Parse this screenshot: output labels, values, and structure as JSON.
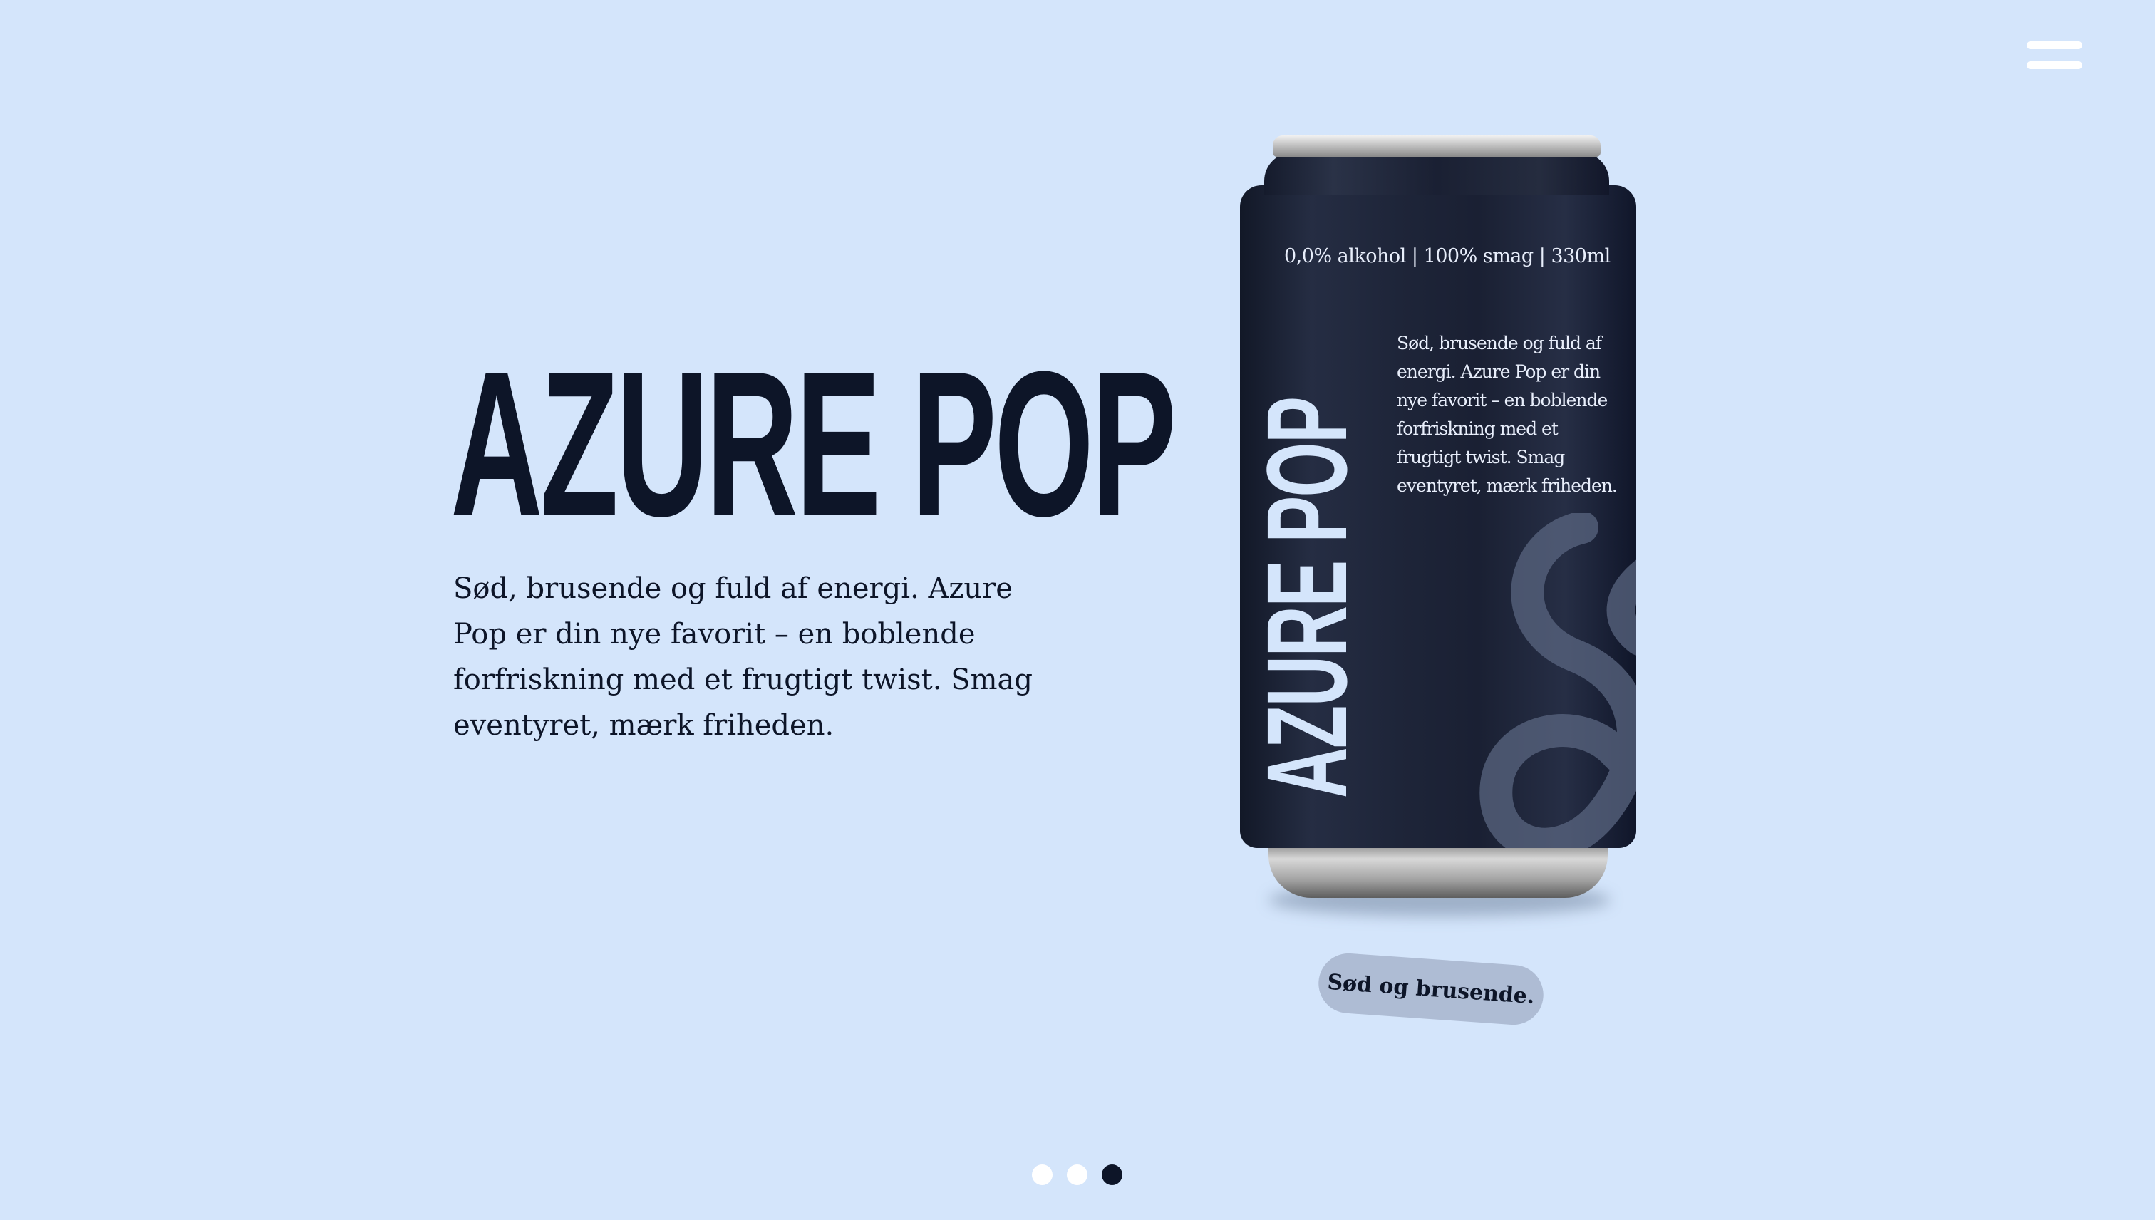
{
  "header": {
    "menu_icon": "hamburger-menu-icon"
  },
  "hero": {
    "title": "AZURE POP",
    "description": "Sød, brusende og fuld af energi. Azure Pop er din nye favorit – en boblende forfriskning med et frugtigt twist. Smag eventyret, mærk friheden."
  },
  "can": {
    "top_label": "0,0% alkohol | 100% smag | 330ml",
    "brand": "AZURE POP",
    "text": "Sød, brusende og fuld af energi. Azure Pop er din nye favorit – en boblende forfriskning med et frugtigt twist. Smag eventyret, mærk friheden.",
    "logo_icon": "swirl-logo-icon"
  },
  "tag": {
    "label": "Sød og brusende."
  },
  "pagination": {
    "dots": [
      {
        "label": "slide-1",
        "active": false
      },
      {
        "label": "slide-2",
        "active": false
      },
      {
        "label": "slide-3",
        "active": true
      }
    ]
  },
  "colors": {
    "background": "#d4e5fb",
    "text": "#0d1528",
    "can": "#1e2539",
    "pill": "#aebcd4"
  }
}
